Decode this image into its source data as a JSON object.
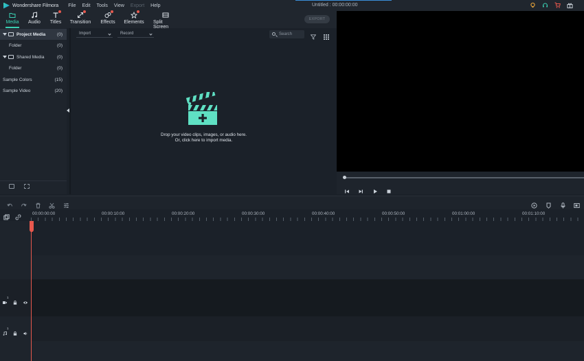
{
  "titlebar": {
    "app_name": "Wondershare Filmora",
    "menu": [
      "File",
      "Edit",
      "Tools",
      "View",
      "Export",
      "Help"
    ],
    "doc_title": "Untitled : 00:00:00:00"
  },
  "tabs": [
    {
      "label": "Media",
      "icon": "media-icon",
      "active": true,
      "badge": false
    },
    {
      "label": "Audio",
      "icon": "music-icon",
      "active": false,
      "badge": false
    },
    {
      "label": "Titles",
      "icon": "titles-icon",
      "active": false,
      "badge": true
    },
    {
      "label": "Transition",
      "icon": "transition-icon",
      "active": false,
      "badge": true
    },
    {
      "label": "Effects",
      "icon": "effects-icon",
      "active": false,
      "badge": true
    },
    {
      "label": "Elements",
      "icon": "elements-icon",
      "active": false,
      "badge": true
    },
    {
      "label": "Split Screen",
      "icon": "split-screen-icon",
      "active": false,
      "badge": false
    }
  ],
  "export_label": "EXPORT",
  "library": {
    "items": [
      {
        "label": "Project Media",
        "count": "(0)"
      },
      {
        "label": "Folder",
        "count": "(0)"
      },
      {
        "label": "Shared Media",
        "count": "(0)"
      },
      {
        "label": "Folder",
        "count": "(0)"
      },
      {
        "label": "Sample Colors",
        "count": "(15)"
      },
      {
        "label": "Sample Video",
        "count": "(20)"
      }
    ]
  },
  "media": {
    "import_label": "Import",
    "record_label": "Record",
    "search_placeholder": "Search",
    "drop_line1": "Drop your video clips, images, or audio here.",
    "drop_line2": "Or, click here to import media."
  },
  "timeline": {
    "ruler_times": [
      "00:00:00:00",
      "00:00:10:00",
      "00:00:20:00",
      "00:00:30:00",
      "00:00:40:00",
      "00:00:50:00",
      "00:01:00:00",
      "00:01:10:00"
    ],
    "video_track_label": "1",
    "audio_track_label": "1"
  },
  "colors": {
    "accent": "#3ad0b3",
    "playhead": "#e8584d",
    "badge": "#e85a4f"
  }
}
